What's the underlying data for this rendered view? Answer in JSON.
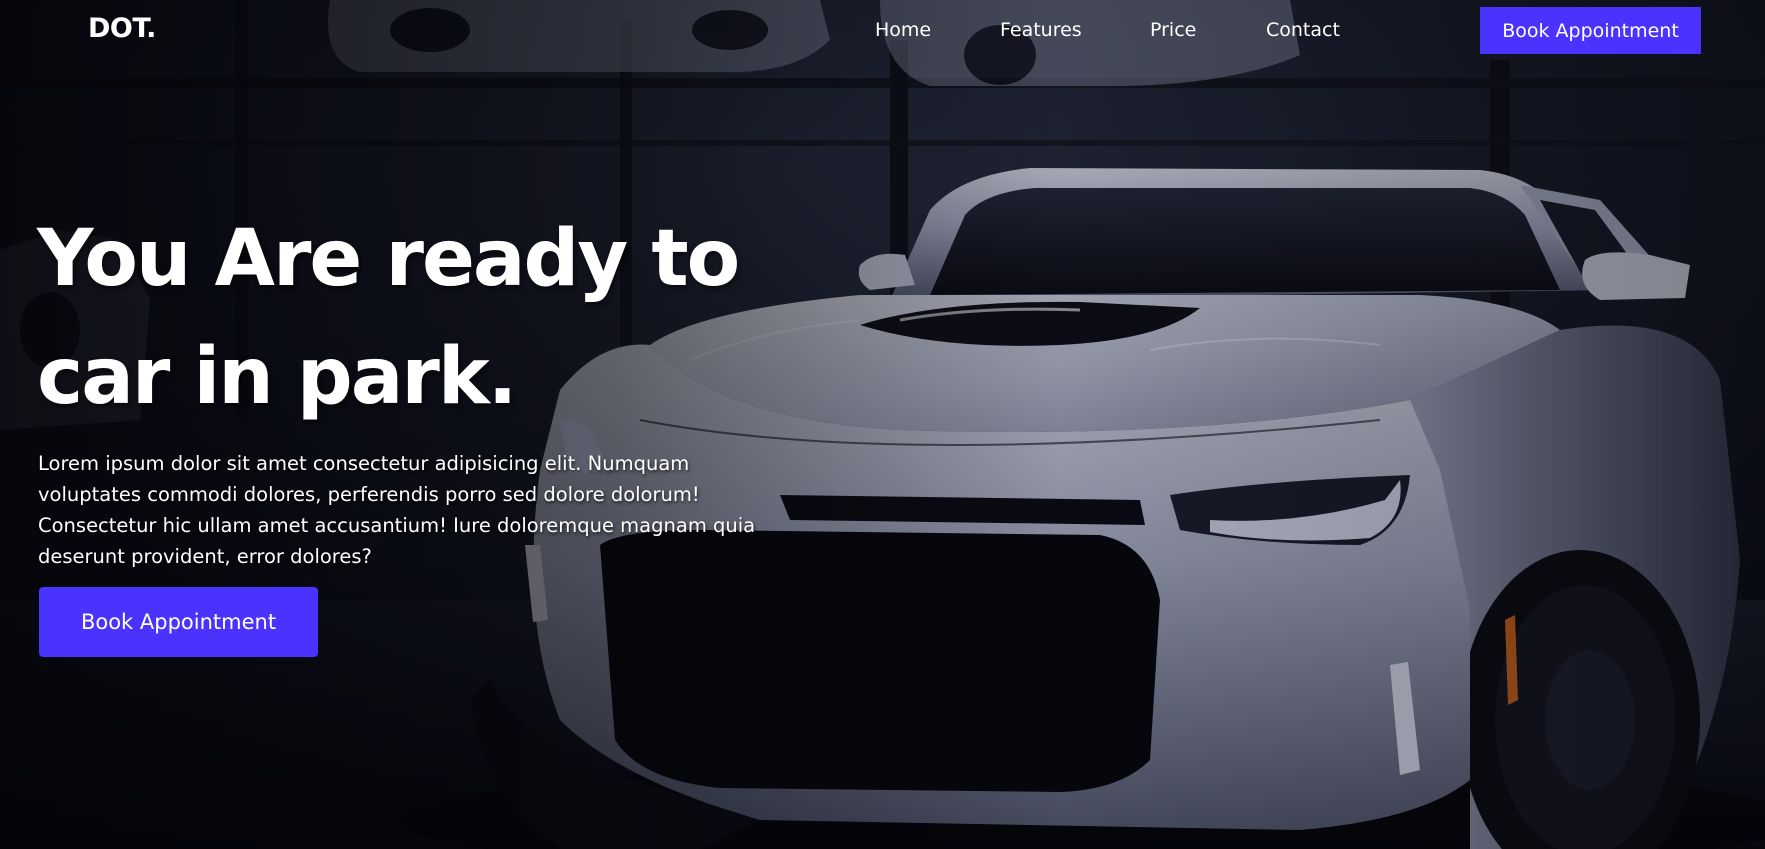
{
  "nav": {
    "logo": "DOT.",
    "links": [
      "Home",
      "Features",
      "Price",
      "Contact"
    ],
    "cta_label": "Book Appointment"
  },
  "hero": {
    "headline_line1": "You Are ready to",
    "headline_line2": "car in park.",
    "body": "Lorem ipsum dolor sit amet consectetur adipisicing elit. Numquam voluptates commodi dolores, perferendis porro sed dolore dolorum! Consectetur hic ullam amet accusantium! Iure doloremque magnam quia deserunt provident, error dolores?",
    "cta_label": "Book Appointment",
    "background_image": "white-sports-car-in-dark-garage"
  },
  "colors": {
    "accent": "#4a33ff",
    "background": "#07080c",
    "text": "#ffffff"
  }
}
